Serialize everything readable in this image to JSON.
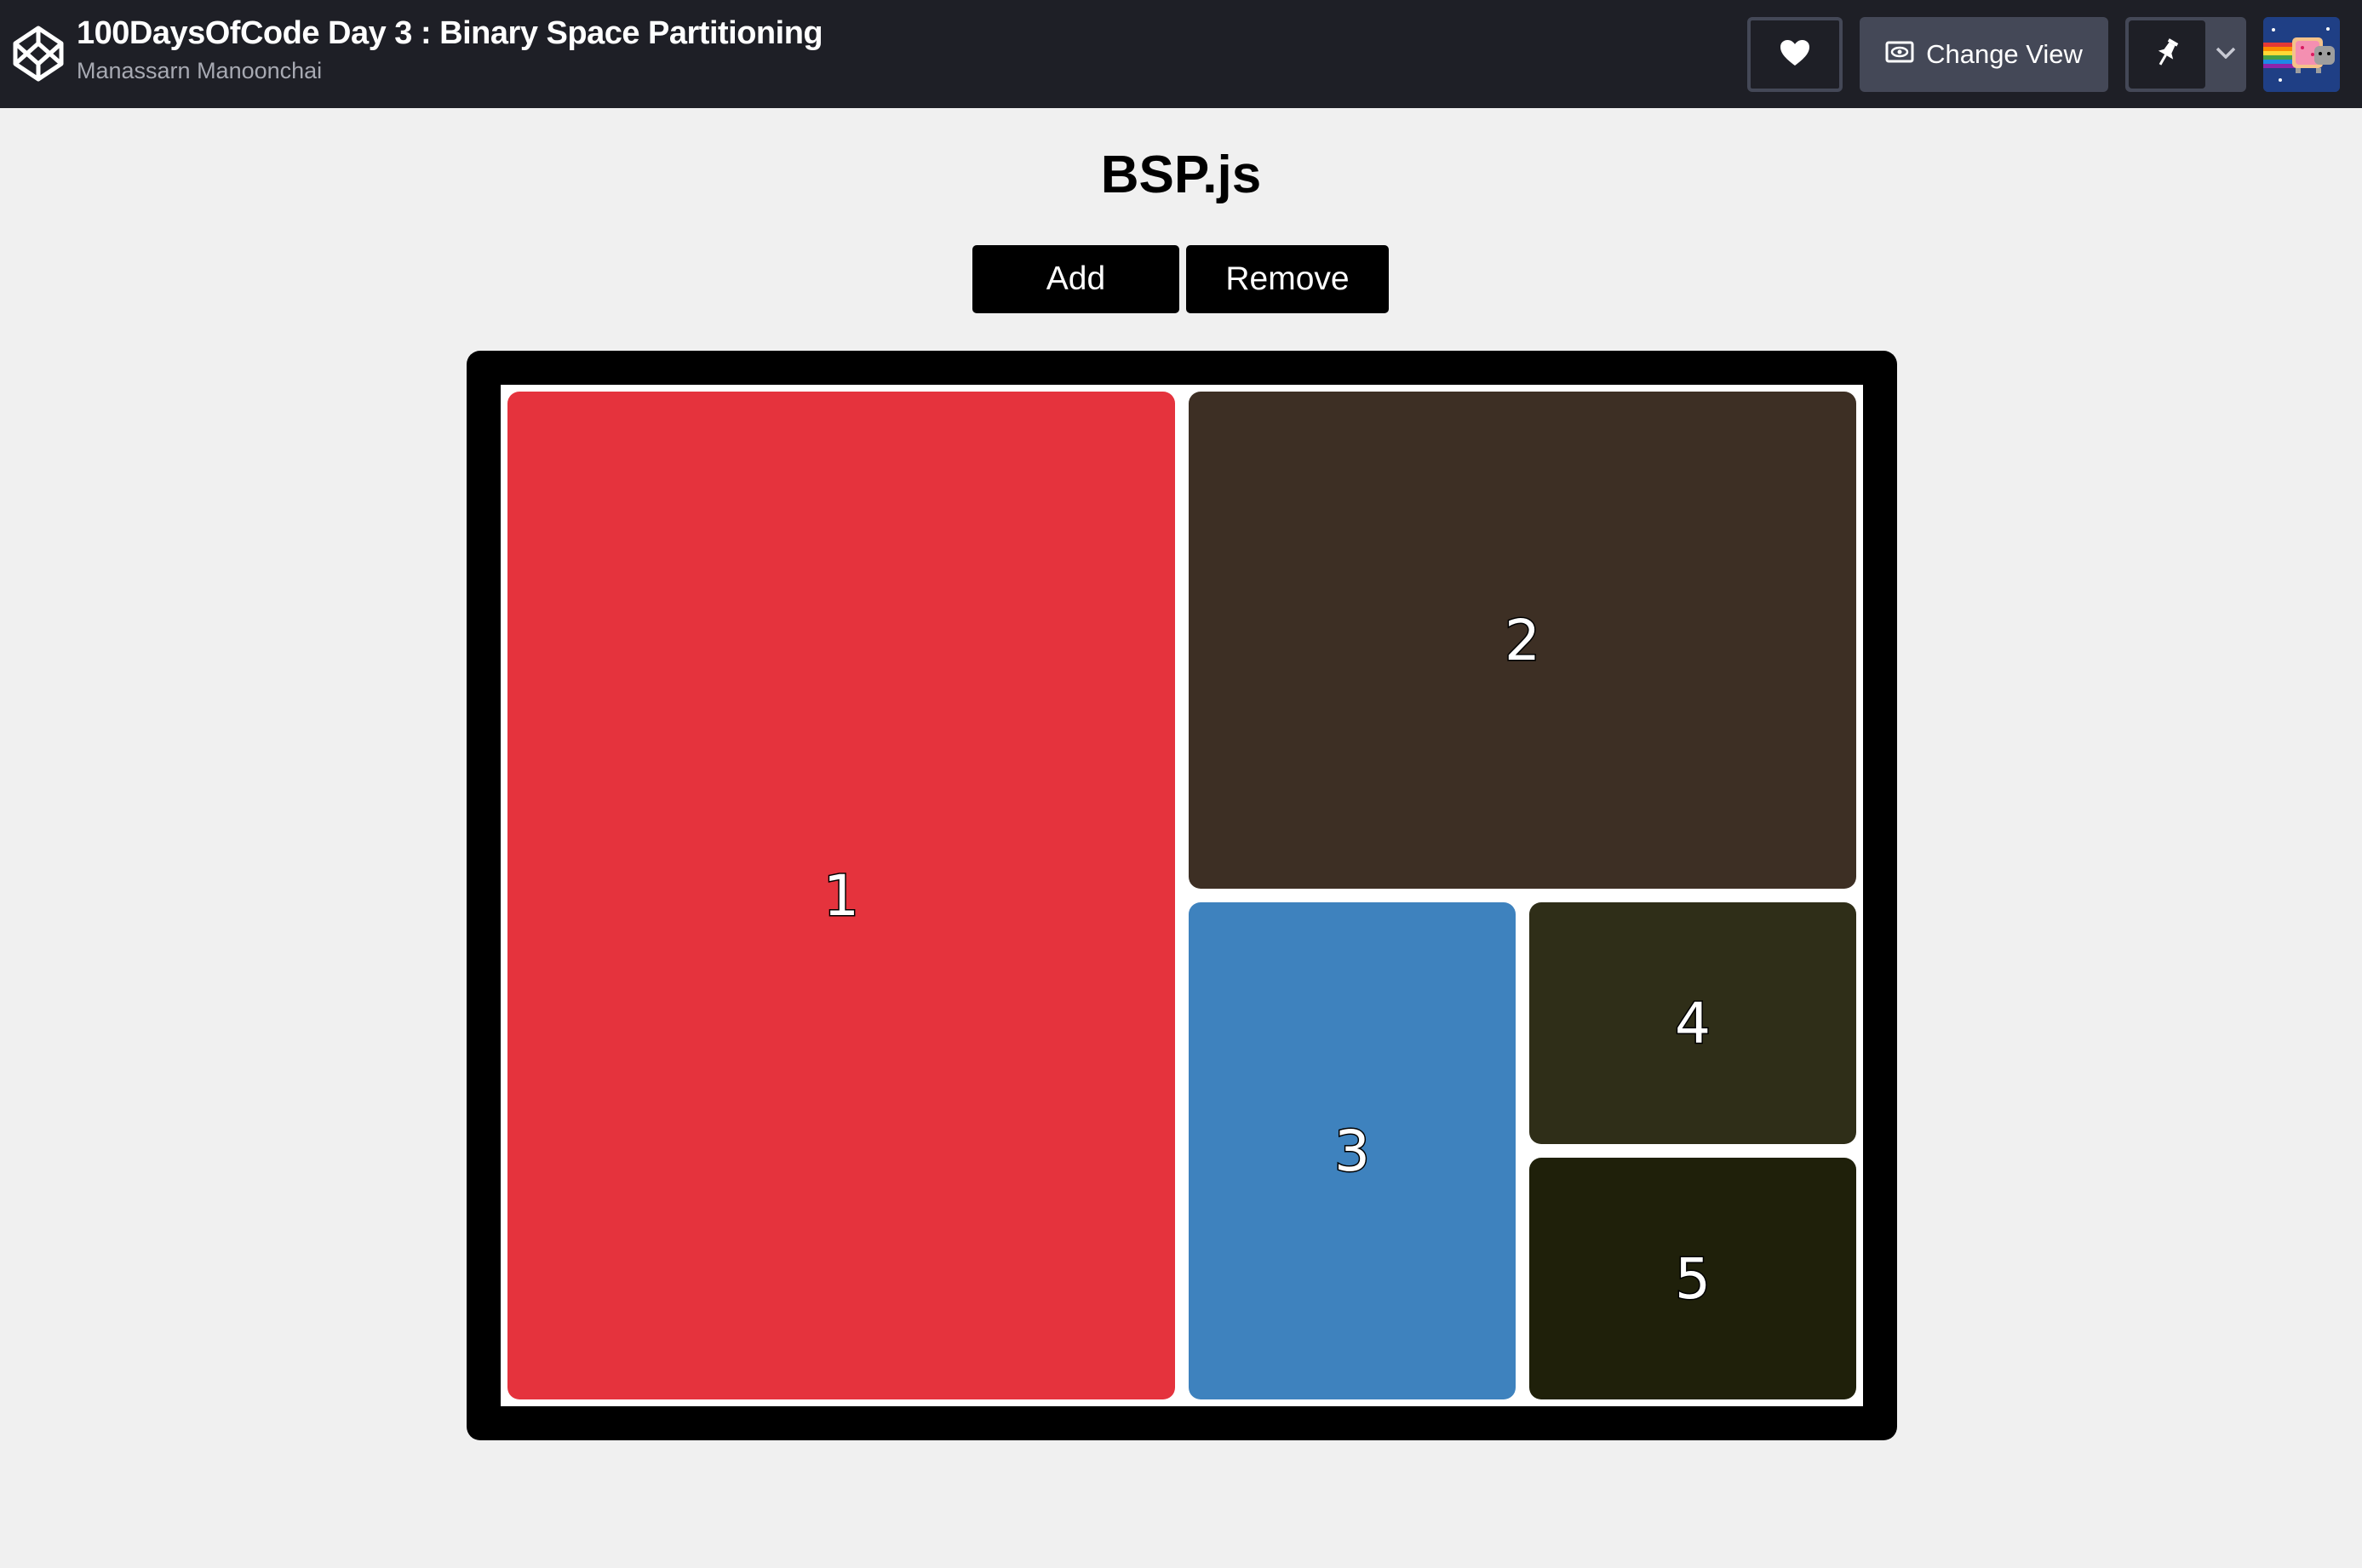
{
  "header": {
    "title": "100DaysOfCode Day 3 : Binary Space Partitioning",
    "author": "Manassarn Manoonchai",
    "logo_icon": "codepen-logo-icon",
    "heart_icon": "heart-icon",
    "change_view_label": "Change View",
    "change_view_icon": "eye-icon",
    "pin_icon": "pin-icon",
    "dropdown_icon": "chevron-down-icon",
    "avatar_icon": "nyan-cat-avatar"
  },
  "main": {
    "heading": "BSP.js",
    "add_label": "Add",
    "remove_label": "Remove"
  },
  "partitions": [
    {
      "label": "1",
      "color": "#e5333d"
    },
    {
      "label": "2",
      "color": "#3d2f24"
    },
    {
      "label": "3",
      "color": "#3e82be"
    },
    {
      "label": "4",
      "color": "#2f2e18"
    },
    {
      "label": "5",
      "color": "#1f200a"
    }
  ]
}
